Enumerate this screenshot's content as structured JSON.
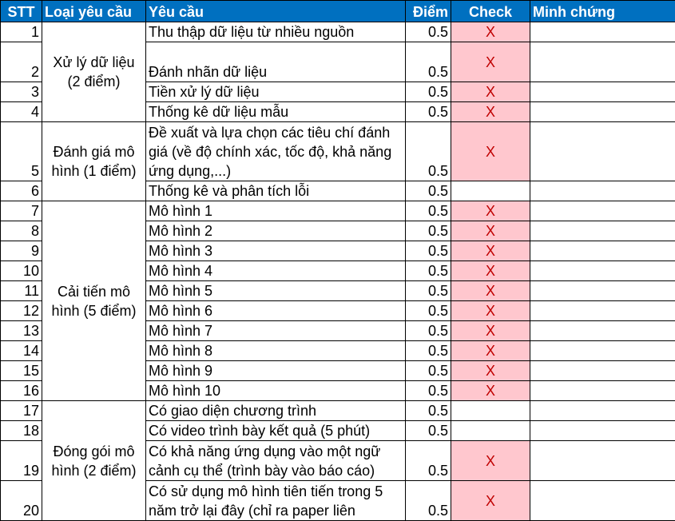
{
  "headers": {
    "stt": "STT",
    "type": "Loại yêu cầu",
    "requirement": "Yêu cầu",
    "points": "Điểm",
    "check": "Check",
    "evidence": "Minh chứng"
  },
  "rows": [
    {
      "stt": "1",
      "req": "Thu thập dữ liệu từ nhiều nguồn",
      "pts": "0.5",
      "check": "X",
      "evidence": "",
      "h": 24,
      "group": {
        "label": "Xử lý dữ liệu (2 điểm)",
        "span": 4
      }
    },
    {
      "stt": "2",
      "req": "Đánh nhãn dữ liệu",
      "pts": "0.5",
      "check": "X",
      "evidence": "",
      "h": 50
    },
    {
      "stt": "3",
      "req": "Tiền xử lý dữ liệu",
      "pts": "0.5",
      "check": "X",
      "evidence": "",
      "h": 24
    },
    {
      "stt": "4",
      "req": "Thống kê dữ liệu mẫu",
      "pts": "0.5",
      "check": "X",
      "evidence": "",
      "h": 24
    },
    {
      "stt": "5",
      "req": "Đề xuất và lựa chọn các tiêu chí đánh giá (về độ chính xác, tốc độ, khả năng ứng dụng,...)",
      "pts": "0.5",
      "check": "X",
      "evidence": "",
      "h": 74,
      "group": {
        "label": "Đánh giá mô hình (1 điểm)",
        "span": 2
      }
    },
    {
      "stt": "6",
      "req": "Thống kê và phân tích lỗi",
      "pts": "0.5",
      "check": "",
      "evidence": "",
      "h": 24
    },
    {
      "stt": "7",
      "req": "Mô hình 1",
      "pts": "0.5",
      "check": "X",
      "evidence": "",
      "h": 24,
      "group": {
        "label": "Cải tiến mô hình (5 điểm)",
        "span": 10
      }
    },
    {
      "stt": "8",
      "req": "Mô hình 2",
      "pts": "0.5",
      "check": "X",
      "evidence": "",
      "h": 24
    },
    {
      "stt": "9",
      "req": "Mô hình 3",
      "pts": "0.5",
      "check": "X",
      "evidence": "",
      "h": 24
    },
    {
      "stt": "10",
      "req": "Mô hình 4",
      "pts": "0.5",
      "check": "X",
      "evidence": "",
      "h": 24
    },
    {
      "stt": "11",
      "req": "Mô hình 5",
      "pts": "0.5",
      "check": "X",
      "evidence": "",
      "h": 24
    },
    {
      "stt": "12",
      "req": "Mô hình 6",
      "pts": "0.5",
      "check": "X",
      "evidence": "",
      "h": 24
    },
    {
      "stt": "13",
      "req": "Mô hình 7",
      "pts": "0.5",
      "check": "X",
      "evidence": "",
      "h": 24
    },
    {
      "stt": "14",
      "req": "Mô hình 8",
      "pts": "0.5",
      "check": "X",
      "evidence": "",
      "h": 24
    },
    {
      "stt": "15",
      "req": "Mô hình 9",
      "pts": "0.5",
      "check": "X",
      "evidence": "",
      "h": 24
    },
    {
      "stt": "16",
      "req": "Mô hình 10",
      "pts": "0.5",
      "check": "X",
      "evidence": "",
      "h": 24
    },
    {
      "stt": "17",
      "req": "Có giao diện chương trình",
      "pts": "0.5",
      "check": "",
      "evidence": "",
      "h": 24,
      "group": {
        "label": "Đóng gói mô hình (2 điểm)",
        "span": 4
      }
    },
    {
      "stt": "18",
      "req": "Có video trình bày kết quả (5 phút)",
      "pts": "0.5",
      "check": "",
      "evidence": "",
      "h": 24
    },
    {
      "stt": "19",
      "req": "Có khả năng ứng dụng vào một ngữ cảnh cụ thể (trình bày vào báo cáo)",
      "pts": "0.5",
      "check": "X",
      "evidence": "",
      "h": 50
    },
    {
      "stt": "20",
      "req": "Có sử dụng mô hình tiên tiến trong 5 năm trở lại đây (chỉ ra paper liên",
      "pts": "0.5",
      "check": "X",
      "evidence": "",
      "h": 50
    }
  ]
}
